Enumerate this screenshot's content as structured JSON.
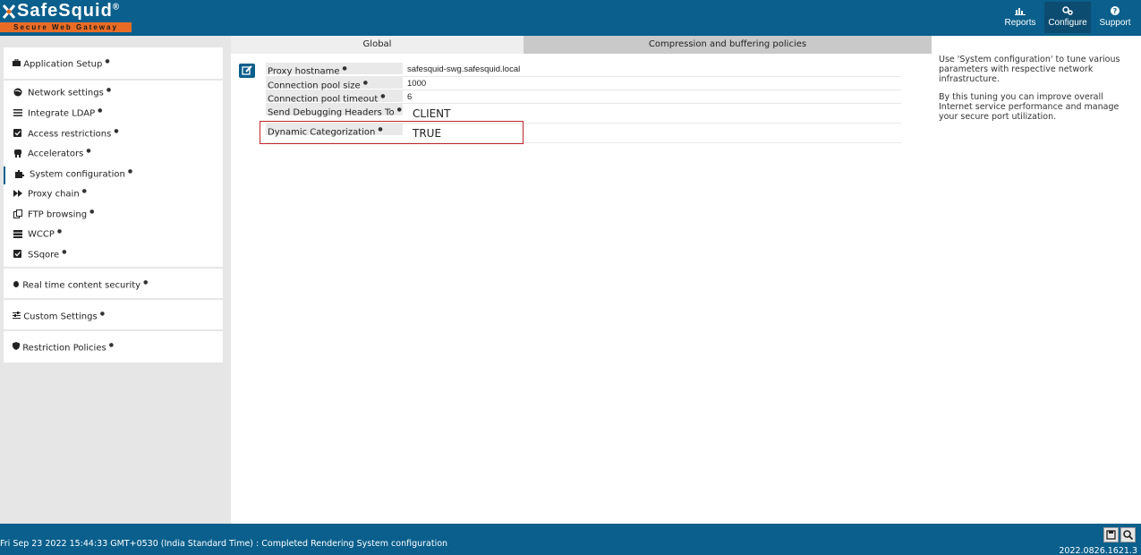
{
  "brand": {
    "name": "SafeSquid",
    "registered": "®",
    "tagline": "Secure Web Gateway"
  },
  "topnav": [
    {
      "label": "Reports",
      "icon": "chart-icon",
      "active": false
    },
    {
      "label": "Configure",
      "icon": "cogs-icon",
      "active": true
    },
    {
      "label": "Support",
      "icon": "question-icon",
      "active": false
    }
  ],
  "sidebar": {
    "app_setup": "Application Setup",
    "items": [
      {
        "label": "Network settings",
        "icon": "globe-icon"
      },
      {
        "label": "Integrate LDAP",
        "icon": "list-icon"
      },
      {
        "label": "Access restrictions",
        "icon": "checkbox-icon"
      },
      {
        "label": "Accelerators",
        "icon": "rocket-icon"
      },
      {
        "label": "System configuration",
        "icon": "puzzle-icon"
      },
      {
        "label": "Proxy chain",
        "icon": "forward-icon"
      },
      {
        "label": "FTP browsing",
        "icon": "copy-icon"
      },
      {
        "label": "WCCP",
        "icon": "server-icon"
      },
      {
        "label": "SSqore",
        "icon": "checkbox-icon"
      }
    ],
    "realtime": "Real time content security",
    "custom": "Custom Settings",
    "restriction": "Restriction Policies"
  },
  "tabs": {
    "global": "Global",
    "compression": "Compression and buffering policies"
  },
  "settings": [
    {
      "label": "Proxy hostname",
      "value": "safesquid-swg.safesquid.local"
    },
    {
      "label": "Connection pool size",
      "value": "1000"
    },
    {
      "label": "Connection pool timeout",
      "value": "6"
    },
    {
      "label": "Send Debugging Headers To",
      "value": "CLIENT"
    },
    {
      "label": "Dynamic Categorization",
      "value": "TRUE"
    }
  ],
  "help": {
    "p1": "Use 'System configuration' to tune various parameters with respective network infrastructure.",
    "p2": "By this tuning you can improve overall Internet service performance and manage your secure port utilization."
  },
  "footer": {
    "status": "Fri Sep 23 2022 15:44:33 GMT+0530 (India Standard Time) : Completed Rendering System configuration",
    "version": "2022.0826.1621.3"
  },
  "colors": {
    "primary": "#0a5f8c",
    "accent": "#e96c25",
    "highlight": "#c0262b"
  }
}
